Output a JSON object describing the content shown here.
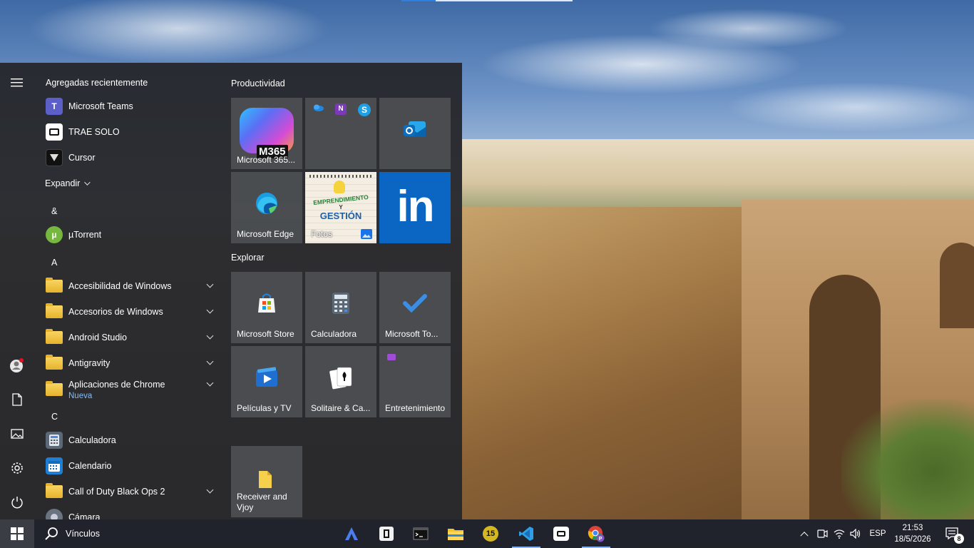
{
  "start_menu": {
    "recent_header": "Agregadas recientemente",
    "recent_apps": [
      {
        "label": "Microsoft Teams",
        "icon": "teams-icon"
      },
      {
        "label": "TRAE SOLO",
        "icon": "trae-icon"
      },
      {
        "label": "Cursor",
        "icon": "cursor-icon"
      }
    ],
    "expand_label": "Expandir",
    "letters": {
      "amp": "&",
      "a": "A",
      "c": "C"
    },
    "apps": {
      "utorrent": "µTorrent",
      "accesibilidad": "Accesibilidad de Windows",
      "accesorios": "Accesorios de Windows",
      "android_studio": "Android Studio",
      "antigravity": "Antigravity",
      "chrome_apps": "Aplicaciones de Chrome",
      "chrome_apps_badge": "Nueva",
      "calculadora": "Calculadora",
      "calendario": "Calendario",
      "cod": "Call of Duty Black Ops 2",
      "camara": "Cámara"
    },
    "groups": {
      "productividad": "Productividad",
      "explorar": "Explorar"
    },
    "tiles": {
      "m365": "Microsoft 365...",
      "m365_badge": "M365",
      "edge": "Microsoft Edge",
      "fotos": "Fotos",
      "fotos_image_text_1": "EMPRENDIMIENTO",
      "fotos_image_text_2": "Y",
      "fotos_image_text_3": "GESTIÓN",
      "linkedin": "in",
      "store": "Microsoft Store",
      "calculadora": "Calculadora",
      "todo": "Microsoft To...",
      "peliculas": "Películas y TV",
      "solitaire": "Solitaire & Ca...",
      "entretenimiento": "Entretenimiento",
      "receiver": "Receiver and Vjoy"
    }
  },
  "taskbar": {
    "search_text": "Vínculos",
    "badge_15": "15",
    "language": "ESP",
    "time": "21:53",
    "date": "18/5/2026",
    "notifications_count": "8"
  },
  "colors": {
    "accent": "#0a66c2",
    "start_bg": "#26282c",
    "taskbar_bg": "#1e2026"
  }
}
